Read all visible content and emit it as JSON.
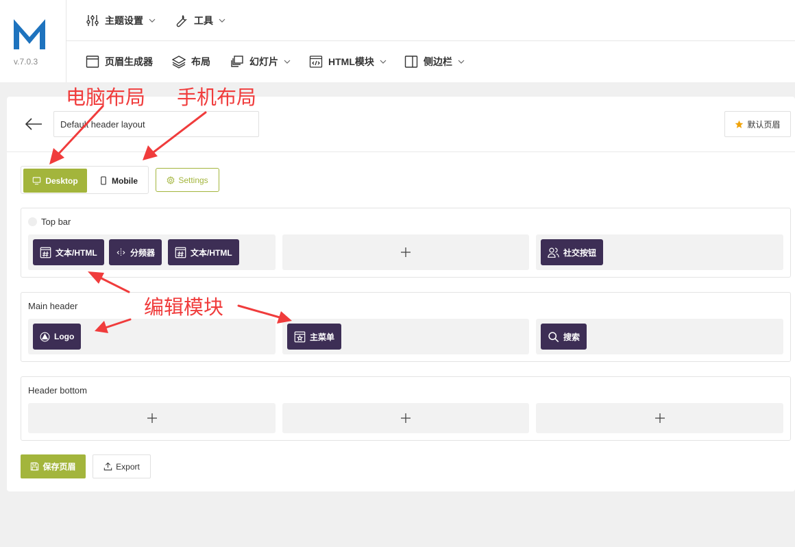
{
  "app": {
    "logo_letter": "M",
    "version": "v.7.0.3",
    "brand_color": "#1e73be"
  },
  "nav": {
    "row1": [
      {
        "label": "主题设置",
        "icon": "sliders-icon",
        "dropdown": true
      },
      {
        "label": "工具",
        "icon": "wrench-icon",
        "dropdown": true
      }
    ],
    "row2": [
      {
        "label": "页眉生成器",
        "icon": "window-icon",
        "dropdown": false
      },
      {
        "label": "布局",
        "icon": "layers-icon",
        "dropdown": false
      },
      {
        "label": "幻灯片",
        "icon": "slides-icon",
        "dropdown": true
      },
      {
        "label": "HTML模块",
        "icon": "code-icon",
        "dropdown": true
      },
      {
        "label": "侧边栏",
        "icon": "sidebar-icon",
        "dropdown": true
      }
    ]
  },
  "editor": {
    "title_value": "Default header layout",
    "default_button": "默认页眉",
    "device_toggle": {
      "desktop": "Desktop",
      "mobile": "Mobile",
      "active": "Desktop"
    },
    "settings_button": "Settings",
    "save_button": "保存页眉",
    "export_button": "Export",
    "accent_color": "#a3b53c",
    "block_color": "#3d2e55"
  },
  "sections": {
    "top_bar": {
      "label": "Top bar",
      "left": [
        {
          "label": "文本/HTML",
          "icon": "hash-icon"
        },
        {
          "label": "分频器",
          "icon": "divider-icon"
        },
        {
          "label": "文本/HTML",
          "icon": "hash-icon"
        }
      ],
      "right": [
        {
          "label": "社交按钮",
          "icon": "users-icon"
        }
      ]
    },
    "main_header": {
      "label": "Main header",
      "left": [
        {
          "label": "Logo",
          "icon": "logo-icon"
        }
      ],
      "center": [
        {
          "label": "主菜单",
          "icon": "menu-icon"
        }
      ],
      "right": [
        {
          "label": "搜索",
          "icon": "search-icon"
        }
      ]
    },
    "header_bottom": {
      "label": "Header bottom"
    }
  },
  "annotations": {
    "desktop_layout": "电脑布局",
    "mobile_layout": "手机布局",
    "edit_modules": "编辑模块",
    "color": "#f03c3c"
  }
}
